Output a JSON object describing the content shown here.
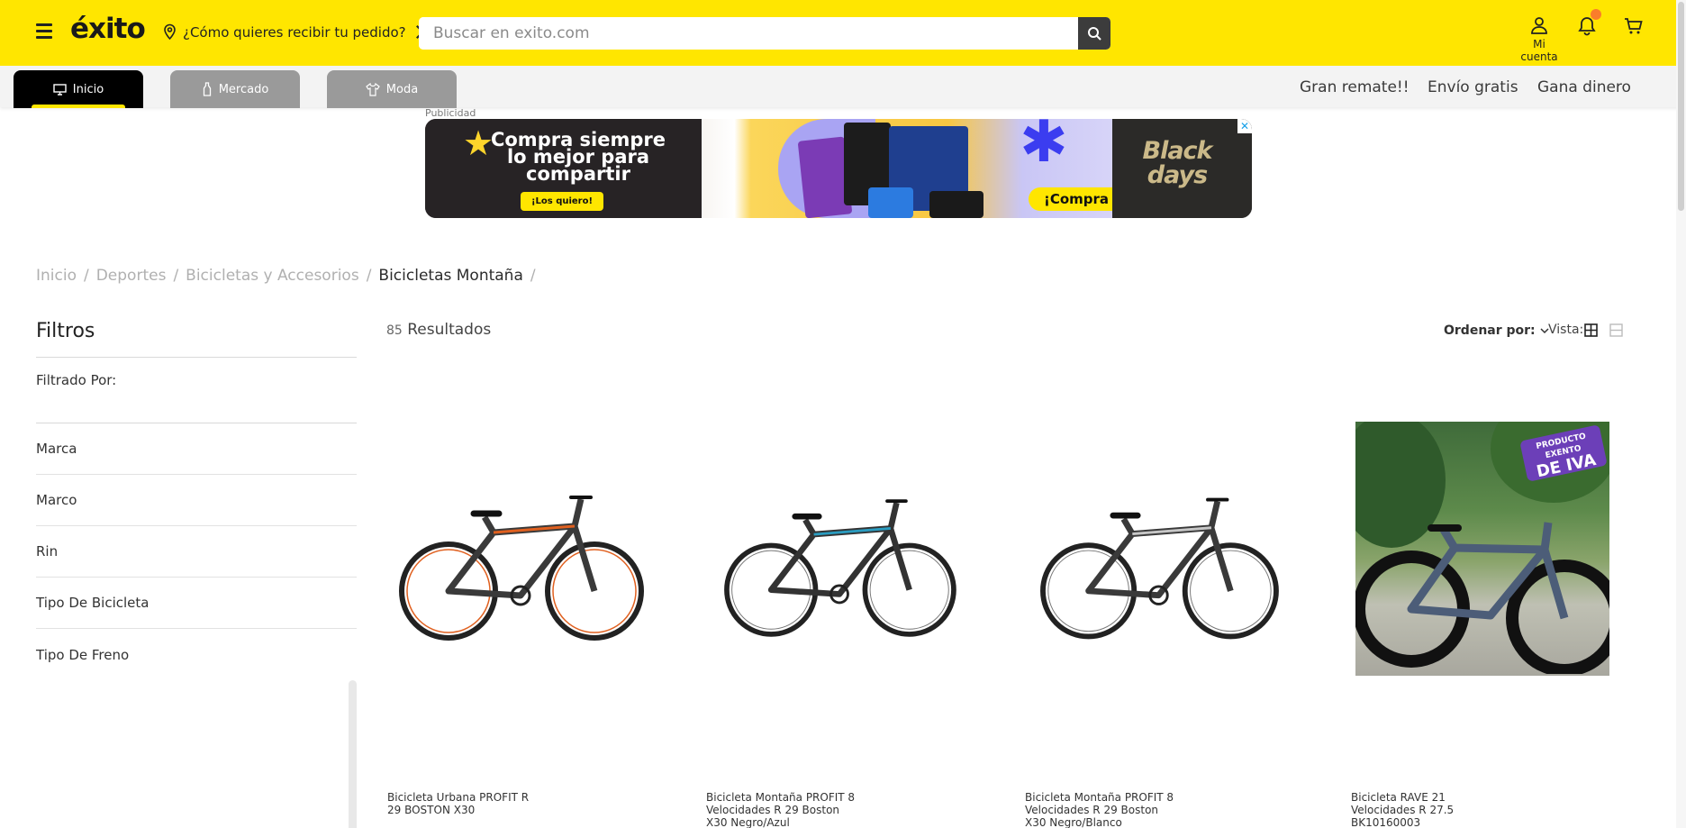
{
  "header": {
    "logo_text": "éxito",
    "delivery_prompt": "¿Cómo quieres recibir tu pedido?",
    "search_placeholder": "Buscar en exito.com",
    "account_label": "Mi cuenta",
    "brand_color": "#ffe600",
    "notification_dot_color": "#fa7d2b"
  },
  "nav": {
    "tabs": [
      {
        "label": "Inicio",
        "icon": "monitor-icon",
        "active": true
      },
      {
        "label": "Mercado",
        "icon": "bottle-icon",
        "active": false
      },
      {
        "label": "Moda",
        "icon": "shirt-icon",
        "active": false
      }
    ],
    "links": [
      "Gran remate!!",
      "Envío gratis",
      "Gana dinero"
    ]
  },
  "ad": {
    "label": "Publicidad",
    "headline": "Compra siempre lo mejor para compartir",
    "cta_left": "¡Los quiero!",
    "cta_right": "¡Compra ya!",
    "promo": "Black days",
    "close": "✕"
  },
  "breadcrumb": {
    "items": [
      "Inicio",
      "Deportes",
      "Bicicletas y Accesorios"
    ],
    "current": "Bicicletas Montaña",
    "separator": "/"
  },
  "filters": {
    "title": "Filtros",
    "filtered_by": "Filtrado Por:",
    "facets": [
      "Marca",
      "Marco",
      "Rin",
      "Tipo De Bicicleta",
      "Tipo De Freno"
    ]
  },
  "results": {
    "count": "85",
    "label": "Resultados",
    "sort_label": "Ordenar por:",
    "view_label": "Vista:"
  },
  "products": [
    {
      "name": "Bicicleta Urbana PROFIT R 29 BOSTON X30",
      "accent": "#e0601f"
    },
    {
      "name": "Bicicleta Montaña PROFIT 8 Velocidades R 29 Boston X30 Negro/Azul",
      "accent": "#2a9cc0"
    },
    {
      "name": "Bicicleta Montaña PROFIT 8 Velocidades R 29 Boston X30 Negro/Blanco",
      "accent": "#9a9a9a"
    },
    {
      "name": "Bicicleta RAVE 21 Velocidades R 27.5 BK10160003",
      "badge_line1": "PRODUCTO EXENTO",
      "badge_line2": "DE IVA"
    }
  ]
}
